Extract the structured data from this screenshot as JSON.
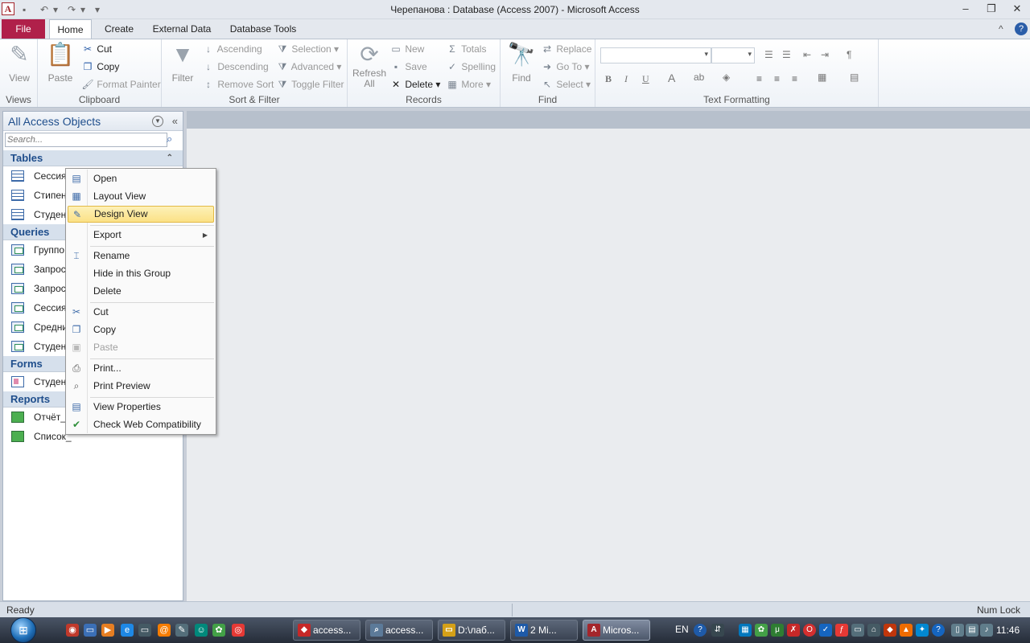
{
  "window": {
    "title": "Черепанова : Database (Access 2007)  -  Microsoft Access",
    "app_icon": "A",
    "controls": [
      "minimize-icon",
      "restore-icon",
      "close-icon"
    ]
  },
  "ribbon_tabs": {
    "file": "File",
    "tabs": [
      "Home",
      "Create",
      "External Data",
      "Database Tools"
    ],
    "active": "Home"
  },
  "ribbon": {
    "views": {
      "label": "Views",
      "view": "View"
    },
    "clipboard": {
      "label": "Clipboard",
      "paste": "Paste",
      "cut": "Cut",
      "copy": "Copy",
      "format_painter": "Format Painter"
    },
    "sort_filter": {
      "label": "Sort & Filter",
      "filter": "Filter",
      "ascending": "Ascending",
      "descending": "Descending",
      "remove_sort": "Remove Sort",
      "selection": "Selection",
      "advanced": "Advanced",
      "toggle_filter": "Toggle Filter"
    },
    "records": {
      "label": "Records",
      "refresh": "Refresh",
      "refresh_all": "All",
      "new": "New",
      "save": "Save",
      "delete": "Delete",
      "totals": "Totals",
      "spelling": "Spelling",
      "more": "More"
    },
    "find": {
      "label": "Find",
      "find": "Find",
      "replace": "Replace",
      "goto": "Go To",
      "select": "Select"
    },
    "text_formatting": {
      "label": "Text Formatting",
      "bold": "B",
      "italic": "I",
      "underline": "U"
    }
  },
  "nav": {
    "title": "All Access Objects",
    "search_placeholder": "Search...",
    "groups": [
      {
        "name": "Tables",
        "items": [
          "Сессия",
          "Стипен",
          "Студент"
        ]
      },
      {
        "name": "Queries",
        "items": [
          "Группо",
          "Запрос",
          "Запрос",
          "Сессия_",
          "Средни",
          "Студент"
        ]
      },
      {
        "name": "Forms",
        "items": [
          "Студент"
        ]
      },
      {
        "name": "Reports",
        "items": [
          "Отчёт_",
          "Список_"
        ]
      }
    ]
  },
  "context_menu": {
    "items": [
      {
        "label": "Open",
        "icon": "open-icon",
        "enabled": true
      },
      {
        "label": "Layout View",
        "icon": "layout-view-icon",
        "enabled": true
      },
      {
        "label": "Design View",
        "icon": "design-view-icon",
        "enabled": true,
        "highlighted": true
      },
      {
        "label": "Export",
        "icon": "",
        "enabled": true,
        "submenu": true
      },
      {
        "label": "Rename",
        "icon": "rename-icon",
        "enabled": true
      },
      {
        "label": "Hide in this Group",
        "icon": "",
        "enabled": true
      },
      {
        "label": "Delete",
        "icon": "",
        "enabled": true
      },
      {
        "label": "Cut",
        "icon": "cut-icon",
        "enabled": true
      },
      {
        "label": "Copy",
        "icon": "copy-icon",
        "enabled": true
      },
      {
        "label": "Paste",
        "icon": "paste-icon",
        "enabled": false
      },
      {
        "label": "Print...",
        "icon": "print-icon",
        "enabled": true
      },
      {
        "label": "Print Preview",
        "icon": "print-preview-icon",
        "enabled": true
      },
      {
        "label": "View Properties",
        "icon": "properties-icon",
        "enabled": true
      },
      {
        "label": "Check Web Compatibility",
        "icon": "check-web-icon",
        "enabled": true
      }
    ]
  },
  "status": {
    "left": "Ready",
    "right": "Num Lock"
  },
  "taskbar": {
    "buttons": [
      "access...",
      "access...",
      "D:\\лаб...",
      "2 Mi...",
      "Micros..."
    ],
    "active": "Micros...",
    "lang": "EN",
    "clock": "11:46"
  },
  "colors": {
    "file_tab": "#b0204a",
    "nav_header": "#1f4e8c",
    "menu_highlight": "#fbe186"
  }
}
